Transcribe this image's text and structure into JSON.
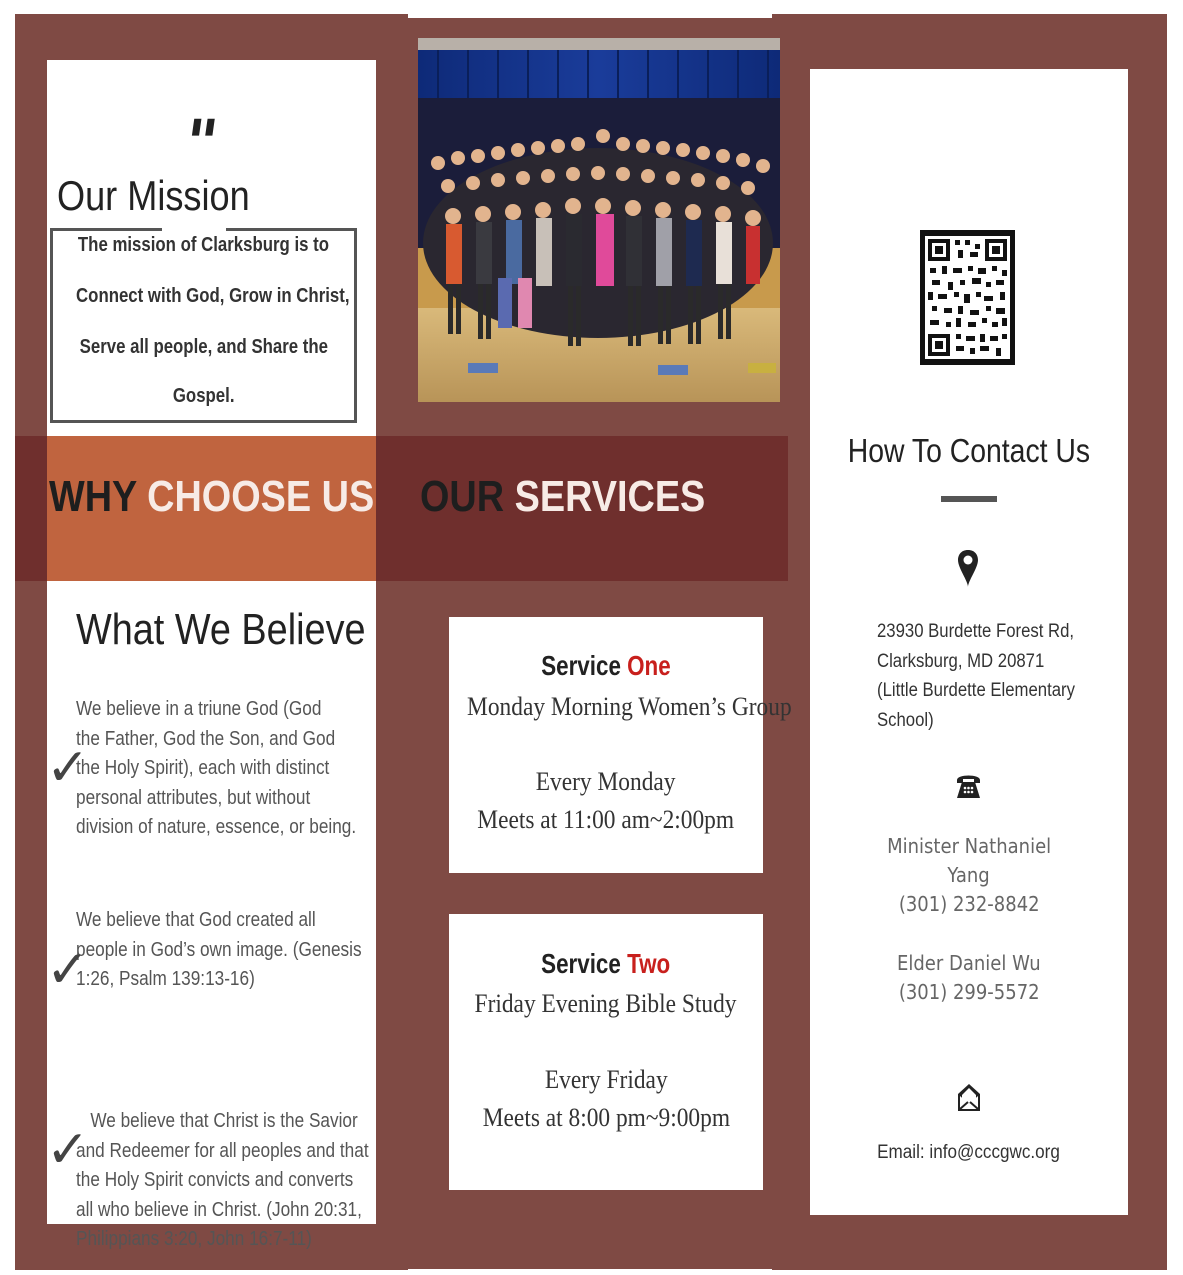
{
  "mission": {
    "quote_mark": "\"",
    "title": "Our Mission",
    "lines": [
      "The mission of Clarksburg is to",
      "Connect with God, Grow  in Christ,",
      "Serve all people, and Share the",
      "Gospel."
    ]
  },
  "why": {
    "dark": "WHY",
    "light": "CHOOSE US"
  },
  "services_head": {
    "dark": "OUR",
    "light": "SERVICES"
  },
  "believe": {
    "title": "What We Believe",
    "items": [
      [
        "We believe in a triune God (God",
        "the Father, God the Son, and God",
        "the Holy Spirit), each with distinct",
        "personal attributes, but without",
        "division of nature, essence, or being."
      ],
      [
        "We believe that God created all",
        "people in God’s own image. (Genesis",
        "1:26, Psalm 139:13-16)"
      ],
      [
        "   We believe that Christ is the Savior",
        "and Redeemer for all peoples and that",
        "the Holy Spirit convicts and converts",
        "all who believe in Christ. (John 20:31,",
        "Philippians 3:20, John 16:7-11)"
      ]
    ]
  },
  "services": [
    {
      "label_a": "Service ",
      "label_b": "One",
      "name": "Monday Morning Women’s  Group",
      "day": "Every Monday",
      "time": "Meets at 11:00 am~2:00pm"
    },
    {
      "label_a": "Service ",
      "label_b": "Two",
      "name": "Friday Evening Bible Study",
      "day": "Every Friday",
      "time": "Meets at 8:00 pm~9:00pm"
    }
  ],
  "contact": {
    "title": "How To Contact Us",
    "address": [
      "23930 Burdette Forest Rd,",
      "Clarksburg, MD 20871",
      "(Little Burdette Elementary",
      "School)"
    ],
    "people": [
      {
        "lines": [
          "Minister Nathaniel",
          "Yang",
          "(301) 232-8842"
        ]
      },
      {
        "lines": [
          "Elder Daniel Wu",
          "(301) 299-5572"
        ]
      }
    ],
    "email": "Email:  info@cccgwc.org"
  },
  "icons": {
    "location": "location-pin-icon",
    "phone": "telephone-icon",
    "email": "envelope-icon",
    "qr": "qr-code-icon"
  },
  "colors": {
    "panel": "#7f4a44",
    "band_dark": "#6f2f2d",
    "band_orange": "#c0643f",
    "accent_red": "#c8201d"
  }
}
